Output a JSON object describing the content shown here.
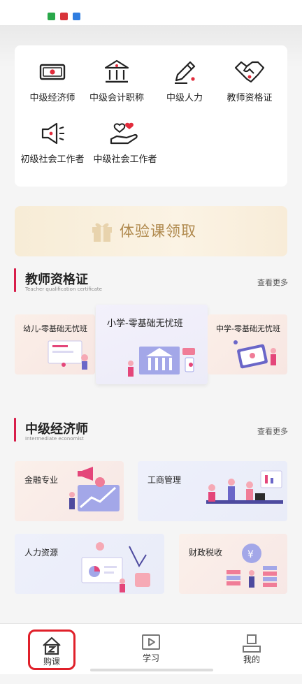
{
  "status_bar": {
    "icons": [
      "app-green-icon",
      "app-red-icon",
      "app-blue-icon"
    ]
  },
  "categories": [
    {
      "label": "中级经济师",
      "icon": "money-icon"
    },
    {
      "label": "中级会计职称",
      "icon": "bank-icon"
    },
    {
      "label": "中级人力",
      "icon": "pencil-icon"
    },
    {
      "label": "教师资格证",
      "icon": "handshake-icon"
    },
    {
      "label": "初级社会工作者",
      "icon": "megaphone-icon"
    },
    {
      "label": "中级社会工作者",
      "icon": "hand-hearts-icon"
    }
  ],
  "banner": {
    "label": "体验课领取"
  },
  "section_teacher": {
    "title": "教师资格证",
    "subtitle": "Teacher qualification certificate",
    "more": "查看更多",
    "courses": [
      "幼儿-零基础无忧班",
      "小学-零基础无忧班",
      "中学-零基础无忧班"
    ]
  },
  "section_economist": {
    "title": "中级经济师",
    "subtitle": "Intermediate economist",
    "more": "查看更多",
    "courses": [
      "金融专业",
      "工商管理",
      "人力资源",
      "财政税收"
    ]
  },
  "tabbar": {
    "tabs": [
      {
        "label": "购课",
        "icon": "cart-z-icon",
        "active": true
      },
      {
        "label": "学习",
        "icon": "play-icon",
        "active": false
      },
      {
        "label": "我的",
        "icon": "person-icon",
        "active": false
      }
    ]
  },
  "colors": {
    "accent": "#d81e4a",
    "highlight_box": "#e0202a",
    "banner_text": "#b08a4e"
  }
}
